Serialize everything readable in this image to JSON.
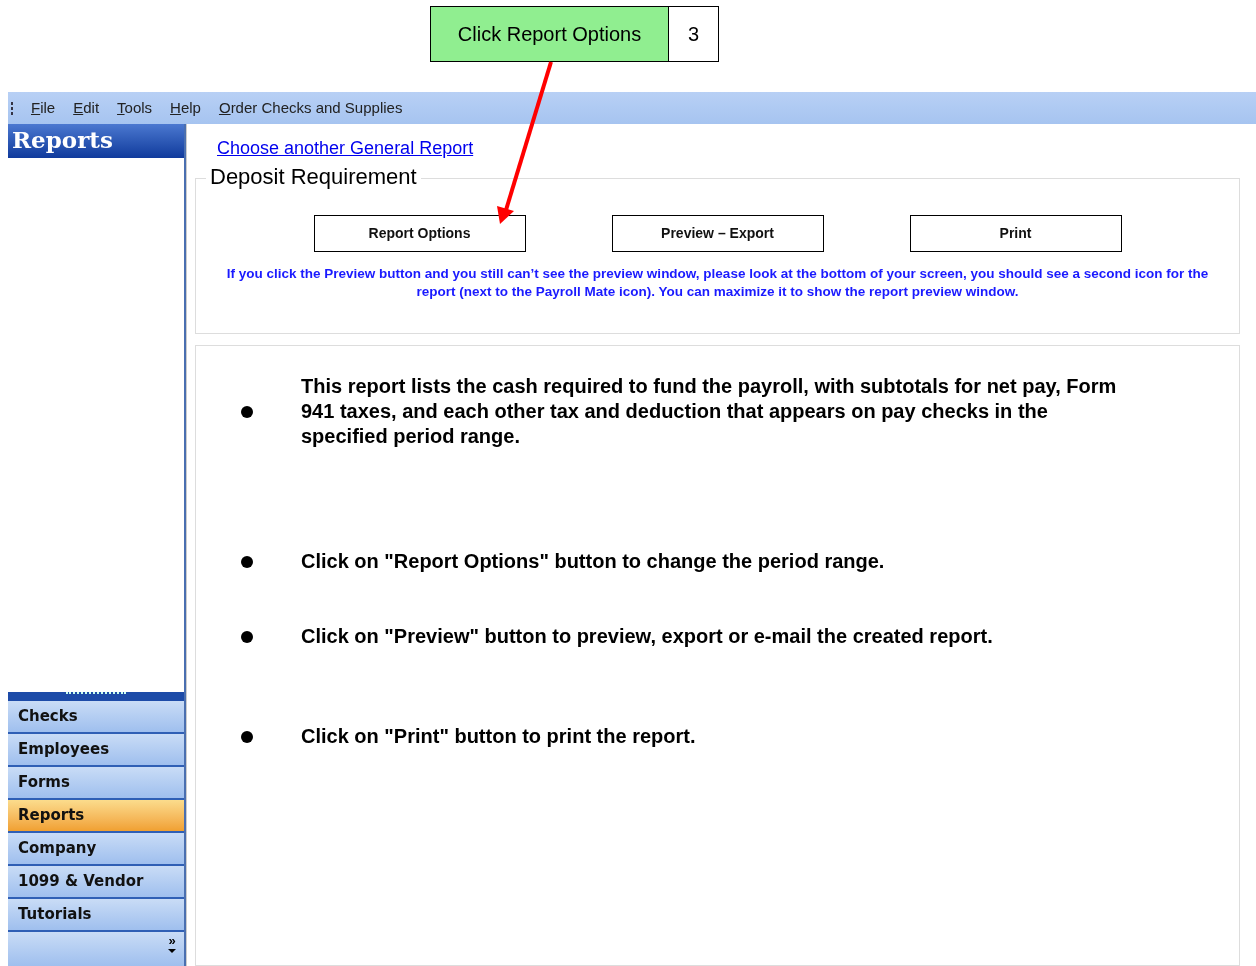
{
  "callout": {
    "text": "Click Report Options",
    "step": "3"
  },
  "menu": [
    {
      "label": "File"
    },
    {
      "label": "Edit"
    },
    {
      "label": "Tools"
    },
    {
      "label": "Help"
    },
    {
      "label": "Order Checks and Supplies"
    }
  ],
  "sidebar": {
    "title": "Reports",
    "items": [
      {
        "label": "Checks",
        "selected": false
      },
      {
        "label": "Employees",
        "selected": false
      },
      {
        "label": "Forms",
        "selected": false
      },
      {
        "label": "Reports",
        "selected": true
      },
      {
        "label": "Company",
        "selected": false
      },
      {
        "label": "1099 & Vendor",
        "selected": false
      },
      {
        "label": "Tutorials",
        "selected": false
      }
    ],
    "overflow": "»"
  },
  "link": "Choose another General Report",
  "group": {
    "title": "Deposit Requirement",
    "buttons": [
      "Report Options",
      "Preview – Export",
      "Print"
    ],
    "note": "If you click the Preview button and you still can’t see the preview window, please look at the bottom of your screen, you should see a second icon for the report (next to the Payroll Mate icon). You can maximize it to show the report preview window."
  },
  "bullets": [
    "This report lists the cash required to fund the payroll, with subtotals for net pay, Form 941 taxes, and each other tax and deduction that appears on pay checks in the specified period range.",
    "Click on \"Report Options\" button to change the period range.",
    "Click on \"Preview\" button to preview, export or e-mail the created report.",
    "Click on \"Print\" button to print the report."
  ]
}
